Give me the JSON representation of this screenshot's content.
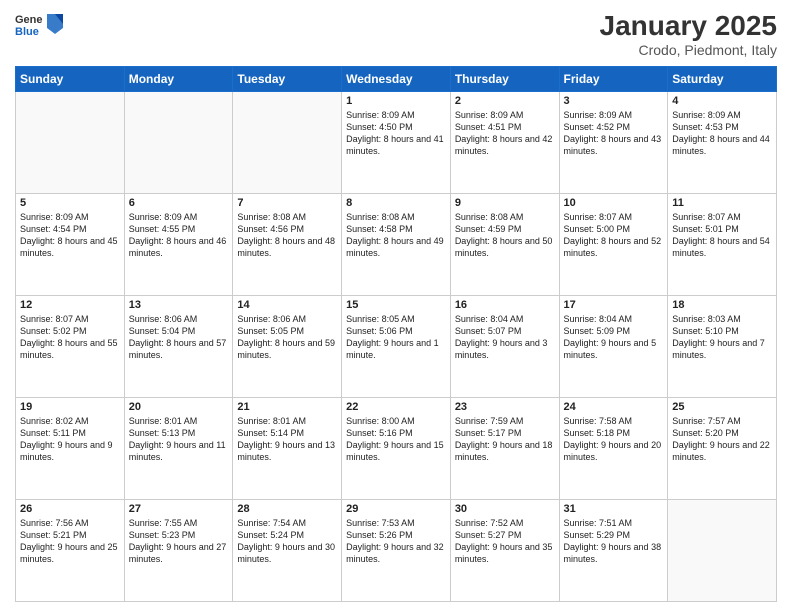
{
  "header": {
    "logo_general": "General",
    "logo_blue": "Blue",
    "month_title": "January 2025",
    "location": "Crodo, Piedmont, Italy"
  },
  "weekdays": [
    "Sunday",
    "Monday",
    "Tuesday",
    "Wednesday",
    "Thursday",
    "Friday",
    "Saturday"
  ],
  "weeks": [
    [
      {
        "day": "",
        "empty": true
      },
      {
        "day": "",
        "empty": true
      },
      {
        "day": "",
        "empty": true
      },
      {
        "day": "1",
        "sunrise": "8:09 AM",
        "sunset": "4:50 PM",
        "daylight": "8 hours and 41 minutes."
      },
      {
        "day": "2",
        "sunrise": "8:09 AM",
        "sunset": "4:51 PM",
        "daylight": "8 hours and 42 minutes."
      },
      {
        "day": "3",
        "sunrise": "8:09 AM",
        "sunset": "4:52 PM",
        "daylight": "8 hours and 43 minutes."
      },
      {
        "day": "4",
        "sunrise": "8:09 AM",
        "sunset": "4:53 PM",
        "daylight": "8 hours and 44 minutes."
      }
    ],
    [
      {
        "day": "5",
        "sunrise": "8:09 AM",
        "sunset": "4:54 PM",
        "daylight": "8 hours and 45 minutes."
      },
      {
        "day": "6",
        "sunrise": "8:09 AM",
        "sunset": "4:55 PM",
        "daylight": "8 hours and 46 minutes."
      },
      {
        "day": "7",
        "sunrise": "8:08 AM",
        "sunset": "4:56 PM",
        "daylight": "8 hours and 48 minutes."
      },
      {
        "day": "8",
        "sunrise": "8:08 AM",
        "sunset": "4:58 PM",
        "daylight": "8 hours and 49 minutes."
      },
      {
        "day": "9",
        "sunrise": "8:08 AM",
        "sunset": "4:59 PM",
        "daylight": "8 hours and 50 minutes."
      },
      {
        "day": "10",
        "sunrise": "8:07 AM",
        "sunset": "5:00 PM",
        "daylight": "8 hours and 52 minutes."
      },
      {
        "day": "11",
        "sunrise": "8:07 AM",
        "sunset": "5:01 PM",
        "daylight": "8 hours and 54 minutes."
      }
    ],
    [
      {
        "day": "12",
        "sunrise": "8:07 AM",
        "sunset": "5:02 PM",
        "daylight": "8 hours and 55 minutes."
      },
      {
        "day": "13",
        "sunrise": "8:06 AM",
        "sunset": "5:04 PM",
        "daylight": "8 hours and 57 minutes."
      },
      {
        "day": "14",
        "sunrise": "8:06 AM",
        "sunset": "5:05 PM",
        "daylight": "8 hours and 59 minutes."
      },
      {
        "day": "15",
        "sunrise": "8:05 AM",
        "sunset": "5:06 PM",
        "daylight": "9 hours and 1 minute."
      },
      {
        "day": "16",
        "sunrise": "8:04 AM",
        "sunset": "5:07 PM",
        "daylight": "9 hours and 3 minutes."
      },
      {
        "day": "17",
        "sunrise": "8:04 AM",
        "sunset": "5:09 PM",
        "daylight": "9 hours and 5 minutes."
      },
      {
        "day": "18",
        "sunrise": "8:03 AM",
        "sunset": "5:10 PM",
        "daylight": "9 hours and 7 minutes."
      }
    ],
    [
      {
        "day": "19",
        "sunrise": "8:02 AM",
        "sunset": "5:11 PM",
        "daylight": "9 hours and 9 minutes."
      },
      {
        "day": "20",
        "sunrise": "8:01 AM",
        "sunset": "5:13 PM",
        "daylight": "9 hours and 11 minutes."
      },
      {
        "day": "21",
        "sunrise": "8:01 AM",
        "sunset": "5:14 PM",
        "daylight": "9 hours and 13 minutes."
      },
      {
        "day": "22",
        "sunrise": "8:00 AM",
        "sunset": "5:16 PM",
        "daylight": "9 hours and 15 minutes."
      },
      {
        "day": "23",
        "sunrise": "7:59 AM",
        "sunset": "5:17 PM",
        "daylight": "9 hours and 18 minutes."
      },
      {
        "day": "24",
        "sunrise": "7:58 AM",
        "sunset": "5:18 PM",
        "daylight": "9 hours and 20 minutes."
      },
      {
        "day": "25",
        "sunrise": "7:57 AM",
        "sunset": "5:20 PM",
        "daylight": "9 hours and 22 minutes."
      }
    ],
    [
      {
        "day": "26",
        "sunrise": "7:56 AM",
        "sunset": "5:21 PM",
        "daylight": "9 hours and 25 minutes."
      },
      {
        "day": "27",
        "sunrise": "7:55 AM",
        "sunset": "5:23 PM",
        "daylight": "9 hours and 27 minutes."
      },
      {
        "day": "28",
        "sunrise": "7:54 AM",
        "sunset": "5:24 PM",
        "daylight": "9 hours and 30 minutes."
      },
      {
        "day": "29",
        "sunrise": "7:53 AM",
        "sunset": "5:26 PM",
        "daylight": "9 hours and 32 minutes."
      },
      {
        "day": "30",
        "sunrise": "7:52 AM",
        "sunset": "5:27 PM",
        "daylight": "9 hours and 35 minutes."
      },
      {
        "day": "31",
        "sunrise": "7:51 AM",
        "sunset": "5:29 PM",
        "daylight": "9 hours and 38 minutes."
      },
      {
        "day": "",
        "empty": true
      }
    ]
  ]
}
